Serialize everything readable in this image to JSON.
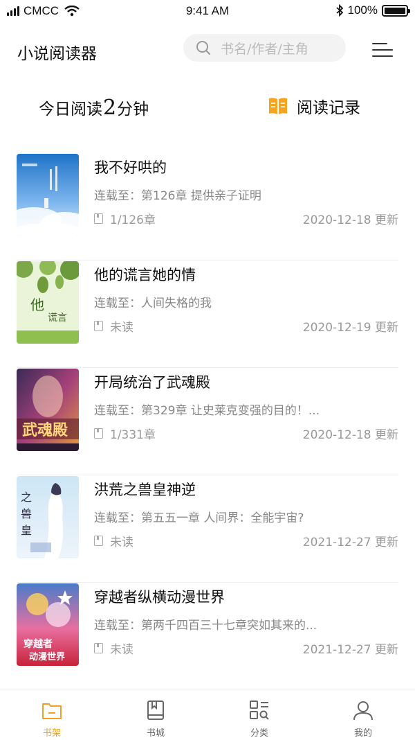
{
  "status_bar": {
    "carrier": "CMCC",
    "time": "9:41 AM",
    "battery": "100%"
  },
  "header": {
    "title": "小说阅读器",
    "search_placeholder": "书名/作者/主角"
  },
  "summary": {
    "today_prefix": "今日阅读",
    "today_minutes": "2",
    "today_suffix": "分钟",
    "history_label": "阅读记录"
  },
  "books": [
    {
      "title": "我不好哄的",
      "latest": "连载至：第126章 提供亲子证明",
      "progress": "1/126章",
      "updated": "2020-12-18 更新"
    },
    {
      "title": "他的谎言她的情",
      "latest": "连载至：人间失格的我",
      "progress": "未读",
      "updated": "2020-12-19 更新"
    },
    {
      "title": "开局统治了武魂殿",
      "latest": "连载至：第329章 让史莱克变强的目的！...",
      "progress": "1/331章",
      "updated": "2020-12-18 更新"
    },
    {
      "title": "洪荒之兽皇神逆",
      "latest": "连载至：第五五一章 人间界：全能宇宙?",
      "progress": "未读",
      "updated": "2021-12-27 更新"
    },
    {
      "title": "穿越者纵横动漫世界",
      "latest": "连载至：第两千四百三十七章突如其来的...",
      "progress": "未读",
      "updated": "2021-12-27 更新"
    }
  ],
  "tabs": [
    {
      "label": "书架",
      "icon": "bookshelf-icon",
      "active": true
    },
    {
      "label": "书城",
      "icon": "bookstore-icon",
      "active": false
    },
    {
      "label": "分类",
      "icon": "category-icon",
      "active": false
    },
    {
      "label": "我的",
      "icon": "profile-icon",
      "active": false
    }
  ],
  "colors": {
    "accent": "#f0a124",
    "text": "#111111",
    "secondary": "#888888"
  }
}
